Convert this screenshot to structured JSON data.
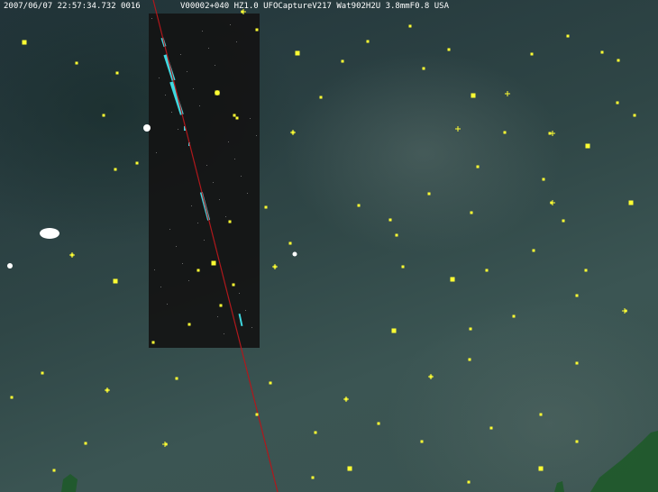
{
  "overlay": {
    "timestamp_frame": "2007/06/07 22:57:34.732 0016",
    "camera_info": "V00002+040 HZ1.0 UFOCaptureV217 Wat902H2U 3.8mmF0.8 USA"
  },
  "colors": {
    "sky": "#31484a",
    "detection_panel": "#151515",
    "meteor_trail": "#3fd8e0",
    "track_line": "#b0181c",
    "star_marker": "#ffff33",
    "cloud_blob": "#ffffff",
    "vegetation": "#1f5a2a"
  }
}
